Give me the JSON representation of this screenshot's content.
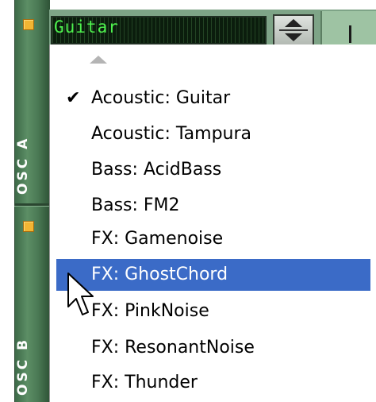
{
  "osc_panel": {
    "osc_a_label": "OSC A",
    "osc_b_label": "OSC B",
    "led_color": "#f2b533",
    "strip_color": "#4b7a55"
  },
  "patch_selector": {
    "display_text": "Guitar",
    "display_color": "#4ef24e"
  },
  "menu": {
    "scroll_up_icon": "triangle-up-icon",
    "items": [
      {
        "label": "Acoustic: Guitar",
        "checked": "✔"
      },
      {
        "label": "Acoustic: Tampura",
        "checked": ""
      },
      {
        "label": "Bass: AcidBass",
        "checked": ""
      },
      {
        "label": "Bass: FM2",
        "checked": ""
      },
      {
        "label": "FX: Gamenoise",
        "checked": ""
      },
      {
        "label": "FX: GhostChord",
        "checked": ""
      },
      {
        "label": "FX: PinkNoise",
        "checked": ""
      },
      {
        "label": "FX: ResonantNoise",
        "checked": ""
      },
      {
        "label": "FX: Thunder",
        "checked": ""
      }
    ],
    "highlighted_index": 5,
    "highlight_color": "#3b6bc7"
  }
}
